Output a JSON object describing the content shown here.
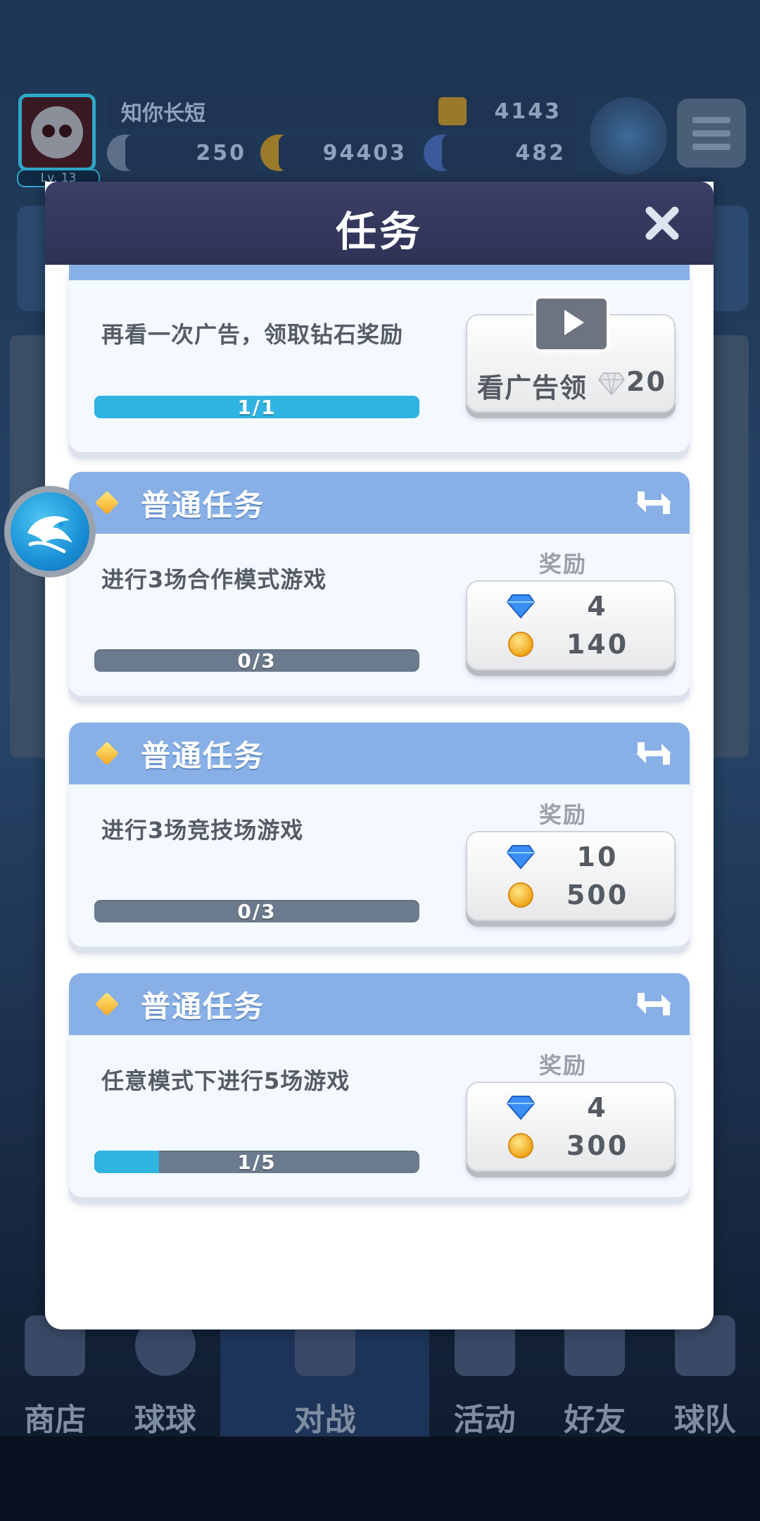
{
  "player": {
    "name": "知你长短",
    "level": "Lv. 13",
    "trophies": "4143",
    "energy": "250",
    "coins": "94403",
    "gems": "482"
  },
  "modal": {
    "title": "任务",
    "ad_task": {
      "description": "再看一次广告，领取钻石奖励",
      "progress_text": "1/1",
      "progress": 1.0,
      "button_label": "看广告领",
      "button_reward": "20"
    },
    "tasks": [
      {
        "header": "普通任务",
        "description": "进行3场合作模式游戏",
        "reward_label": "奖励",
        "gems": "4",
        "coins": "140",
        "progress_text": "0/3",
        "progress": 0.0
      },
      {
        "header": "普通任务",
        "description": "进行3场竞技场游戏",
        "reward_label": "奖励",
        "gems": "10",
        "coins": "500",
        "progress_text": "0/3",
        "progress": 0.0
      },
      {
        "header": "普通任务",
        "description": "任意模式下进行5场游戏",
        "reward_label": "奖励",
        "gems": "4",
        "coins": "300",
        "progress_text": "1/5",
        "progress": 0.2
      }
    ]
  },
  "bottom_nav": [
    {
      "label": "商店"
    },
    {
      "label": "球球"
    },
    {
      "label": "对战"
    },
    {
      "label": "活动"
    },
    {
      "label": "好友"
    },
    {
      "label": "球队"
    }
  ],
  "colors": {
    "card_header": "#88b0e6",
    "progress_fill": "#2fb4e2",
    "progress_track": "#6b7a8c",
    "modal_header": "#2f3255"
  }
}
